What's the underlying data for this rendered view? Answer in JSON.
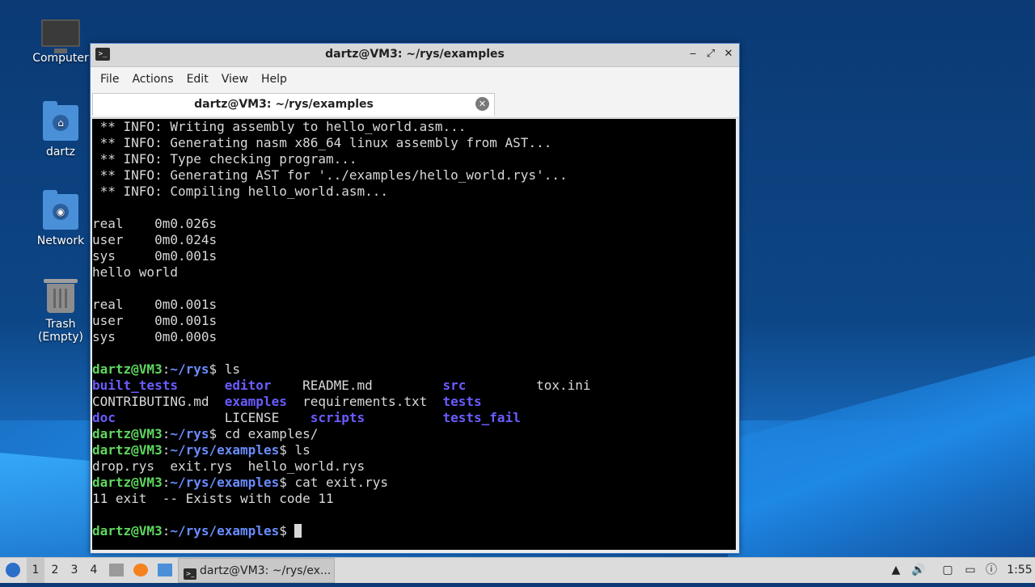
{
  "desktop": {
    "icons": [
      {
        "label": "Computer"
      },
      {
        "label": "dartz"
      },
      {
        "label": "Network"
      },
      {
        "label": "Trash (Empty)"
      }
    ]
  },
  "window": {
    "title": "dartz@VM3: ~/rys/examples",
    "controls": {
      "minimize": "‒",
      "maximize": "⤢",
      "close": "✕"
    },
    "menu": [
      "File",
      "Actions",
      "Edit",
      "View",
      "Help"
    ],
    "tab": {
      "label": "dartz@VM3: ~/rys/examples",
      "close": "✕"
    }
  },
  "terminal": {
    "lines": {
      "l1": " ** INFO: Writing assembly to hello_world.asm...",
      "l2": " ** INFO: Generating nasm x86_64 linux assembly from AST...",
      "l3": " ** INFO: Type checking program...",
      "l4": " ** INFO: Generating AST for '../examples/hello_world.rys'...",
      "l5": " ** INFO: Compiling hello_world.asm...",
      "l7": "real\t0m0.026s",
      "l8": "user\t0m0.024s",
      "l9": "sys\t0m0.001s",
      "l10": "hello world",
      "l12": "real\t0m0.001s",
      "l13": "user\t0m0.001s",
      "l14": "sys\t0m0.000s"
    },
    "prompt_user": "dartz@VM3",
    "path_rys": "~/rys",
    "path_examples": "~/rys/examples",
    "ls_cmd": "ls",
    "ls_listing": {
      "r1": [
        {
          "name": "built_tests",
          "dir": true
        },
        {
          "name": "editor",
          "dir": true
        },
        {
          "name": "README.md",
          "dir": false
        },
        {
          "name": "src",
          "dir": true
        },
        {
          "name": "tox.ini",
          "dir": false
        }
      ],
      "r2": [
        {
          "name": "CONTRIBUTING.md",
          "dir": false
        },
        {
          "name": "examples",
          "dir": true
        },
        {
          "name": "requirements.txt",
          "dir": false
        },
        {
          "name": "tests",
          "dir": true
        }
      ],
      "r3": [
        {
          "name": "doc",
          "dir": true
        },
        {
          "name": "LICENSE",
          "dir": false
        },
        {
          "name": "scripts",
          "dir": true
        },
        {
          "name": "tests_fail",
          "dir": true
        }
      ]
    },
    "cd_cmd": "cd examples/",
    "ls2_output": "drop.rys  exit.rys  hello_world.rys",
    "cat_cmd": "cat exit.rys",
    "cat_output": "11 exit  -- Exists with code 11"
  },
  "taskbar": {
    "workspaces": [
      "1",
      "2",
      "3",
      "4"
    ],
    "task_label": "dartz@VM3: ~/rys/ex...",
    "clock": "1:55"
  }
}
